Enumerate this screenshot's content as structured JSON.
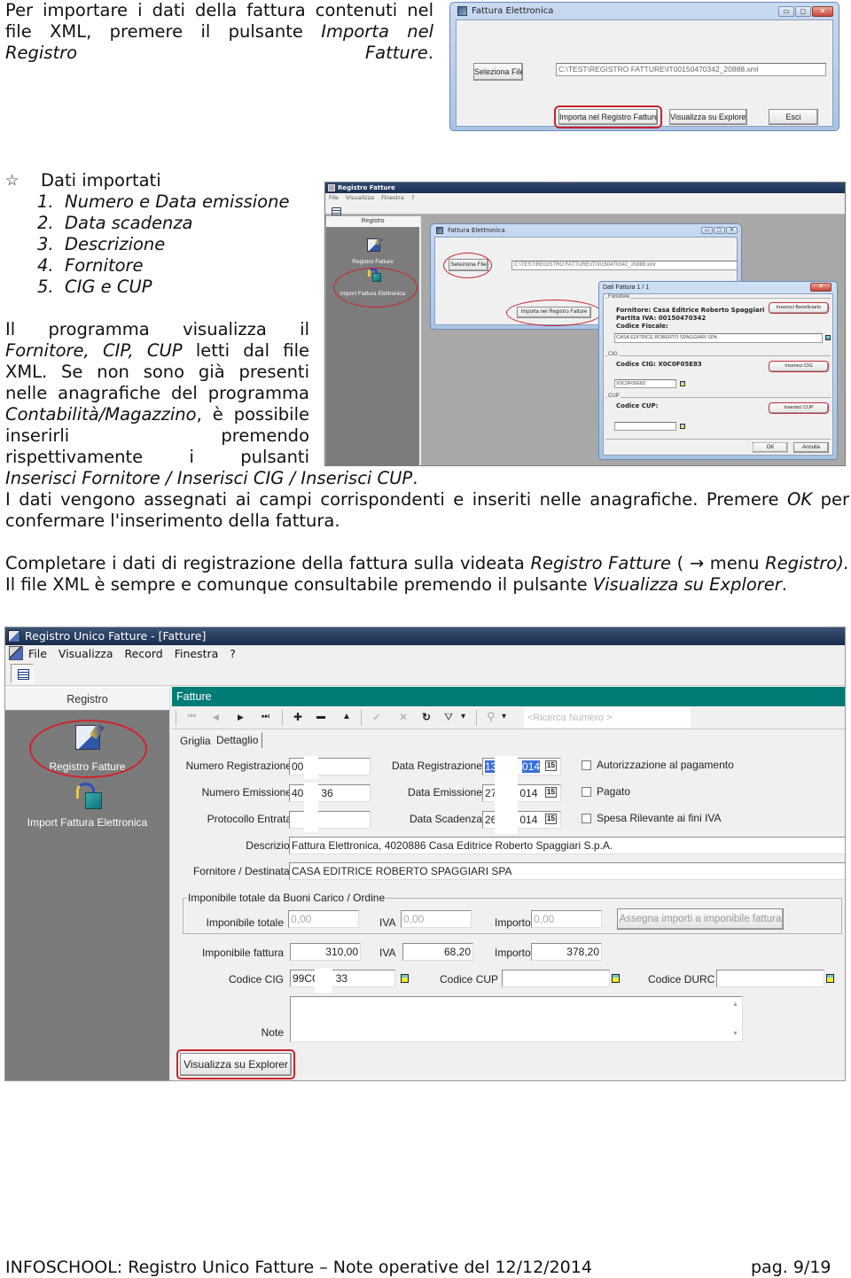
{
  "doc": {
    "intro": {
      "pre": "Per importare i dati della fattura contenuti nel file XML, premere il pulsante ",
      "em": "Importa nel Registro Fatture",
      "post": "."
    },
    "imported_heading": "Dati importati",
    "imported_items": [
      "1.  Numero e Data emissione",
      "2.  Data scadenza",
      "3.  Descrizione",
      "4.  Fornitore",
      "5.  CIG e CUP"
    ],
    "para2": {
      "l1": "Il programma visualizza il",
      "l2_em": "Fornitore, CIP, CUP",
      "l2_post": " letti dal file",
      "l3": "XML. Se non sono già presenti",
      "l4": "nelle anagrafiche del programma",
      "l5_em": "Contabilità/Magazzino",
      "l5_post": ", è possibile",
      "l6": "inserirli premendo",
      "l7": "rispettivamente i pulsanti",
      "l8_em": "Inserisci Fornitore / Inserisci CIG / Inserisci CUP",
      "l8_post": "."
    },
    "para3": {
      "pre": "I dati vengono assegnati ai campi corrispondenti e inseriti nelle anagrafiche. Premere ",
      "em": "OK",
      "post": " per confermare l'inserimento della fattura."
    },
    "para4": {
      "pre": "Completare i dati di registrazione della fattura sulla videata ",
      "em1": "Registro Fatture",
      "mid1": " ( ",
      "arrow": "→",
      "mid2": " menu ",
      "em2": "Registro).",
      "mid3": " Il file XML è sempre e comunque consultabile premendo il pulsante ",
      "em3": "Visualizza su Explorer",
      "post": "."
    },
    "footer": {
      "left": "INFOSCHOOL: Registro Unico Fatture – Note operative del 12/12/2014",
      "right": "pag. 9/19"
    }
  },
  "shot1": {
    "title": "Fattura Elettronica",
    "select_file": "Seleziona File",
    "file_path": "C:\\TEST\\REGISTRO FATTURE\\IT00150470342_20888.xml",
    "import_btn": "Importa nel Registro Fatture",
    "explorer_btn": "Visualizza su Explorer",
    "exit_btn": "Esci",
    "win_buttons": [
      "▭",
      "◻",
      "✕"
    ]
  },
  "shot2": {
    "app_title": "Registro Fatture",
    "menu": [
      "File",
      "Visualizza",
      "Finestra",
      "?"
    ],
    "side_header": "Registro",
    "side_items": [
      "Registro Fatture",
      "Import Fattura Elettronica"
    ],
    "inner": {
      "title": "Fattura Elettronica",
      "select_file": "Seleziona File",
      "file_path": "C:\\TEST\\REGISTRO FATTURE\\IT00150470342_20888.xml",
      "import_btn": "Importa nel Registro Fatture"
    },
    "dialog": {
      "title": "Dati Fattura 1 / 1",
      "close": "✕",
      "fornitore_group": "Fornitore",
      "fornitore_line": "Fornitore: Casa Editrice Roberto Spaggiari",
      "piva_line": "Partita IVA: 00150470342",
      "cf_line": "Codice Fiscale:",
      "fornitore_value": "CASA EDITRICE ROBERTO SPAGGIARI SPA",
      "ins_benef": "Inserisci Beneficiario",
      "cig_group": "CIG",
      "cig_line": "Codice CIG: X0C0F05E83",
      "cig_value": "X0C0F05E83",
      "ins_cig": "Inserisci CIG",
      "cup_group": "CUP",
      "cup_line": "Codice CUP:",
      "cup_value": "",
      "ins_cup": "Inserisci CUP",
      "ok": "OK",
      "cancel": "Annulla"
    }
  },
  "shot3": {
    "title": "Registro Unico Fatture - [Fatture]",
    "menu": [
      "File",
      "Visualizza",
      "Record",
      "Finestra",
      "?"
    ],
    "side_header": "Registro",
    "side_items": [
      "Registro Fatture",
      "Import Fattura Elettronica"
    ],
    "panel_title": "Fatture",
    "nav": {
      "first": "⏮",
      "prev": "◀",
      "next": "▶",
      "last": "⏭",
      "add": "✚",
      "remove": "▬",
      "up": "▲",
      "confirm": "✓",
      "cancel": "✕",
      "refresh": "↻",
      "filter": "⛛",
      "dropdown": "▾",
      "search_icon": "⚲",
      "search_placeholder": "<Ricerca Numero >"
    },
    "tabs": [
      "Griglia",
      "Dettaglio"
    ],
    "form": {
      "numero_registrazione": {
        "label": "Numero Registrazione",
        "value": "00"
      },
      "numero_emissione": {
        "label": "Numero Emissione",
        "value": "40",
        "value_tail": "36"
      },
      "protocollo_entrata": {
        "label": "Protocollo Entrata",
        "value": ""
      },
      "data_registrazione": {
        "label": "Data Registrazione",
        "value": "13",
        "value_tail": "014"
      },
      "data_emissione": {
        "label": "Data Emissione",
        "value": "27",
        "value_tail": "014"
      },
      "data_scadenza": {
        "label": "Data Scadenza",
        "value": "26",
        "value_tail": "014"
      },
      "calendar_glyph": "15",
      "autorizzazione": {
        "label": "Autorizzazione al pagamento",
        "checked": false
      },
      "pagato": {
        "label": "Pagato",
        "checked": false
      },
      "spesa_rilevante": {
        "label": "Spesa Rilevante ai fini IVA",
        "checked": false
      },
      "descrizione": {
        "label": "Descrizione",
        "value": "Fattura Elettronica, 4020886 Casa Editrice Roberto Spaggiari S.p.A."
      },
      "fornitore": {
        "label": "Fornitore / Destinatario",
        "value": "CASA EDITRICE ROBERTO SPAGGIARI SPA"
      },
      "buoni_group": "Imponibile totale da Buoni Carico / Ordine",
      "imponibile_totale": {
        "label": "Imponibile totale",
        "value": "0,00"
      },
      "iva_totale": {
        "label": "IVA",
        "value": "0,00"
      },
      "importo_totale": {
        "label": "Importo",
        "value": "0,00"
      },
      "assegna_btn": "Assegna importi a imponibile fattura",
      "imponibile_fattura": {
        "label": "Imponibile fattura",
        "value": "310,00"
      },
      "iva_fattura": {
        "label": "IVA",
        "value": "68,20"
      },
      "importo_fattura": {
        "label": "Importo",
        "value": "378,20"
      },
      "codice_cig": {
        "label": "Codice CIG",
        "value": "99CC",
        "value_tail": "33"
      },
      "codice_cup": {
        "label": "Codice CUP",
        "value": ""
      },
      "codice_durc": {
        "label": "Codice DURC",
        "value": ""
      },
      "note": {
        "label": "Note",
        "value": ""
      },
      "explorer_btn": "Visualizza su Explorer"
    }
  }
}
